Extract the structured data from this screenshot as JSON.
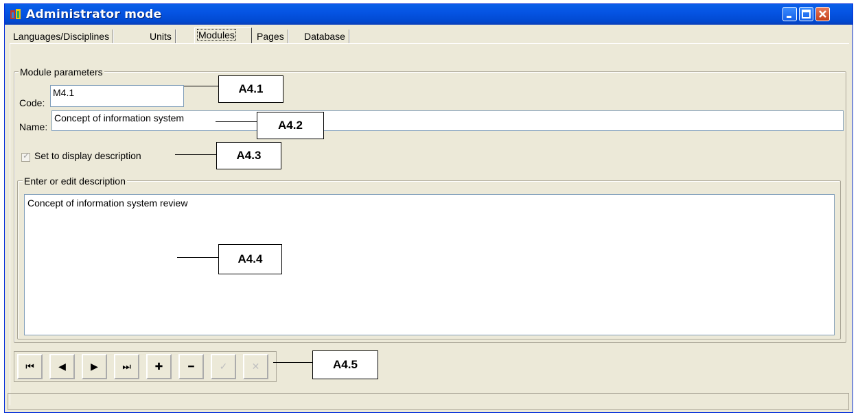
{
  "window": {
    "title": "Administrator mode"
  },
  "tabs": [
    {
      "label": "Languages/Disciplines"
    },
    {
      "label": "Units"
    },
    {
      "label": "Modules"
    },
    {
      "label": "Pages"
    },
    {
      "label": "Database"
    }
  ],
  "module_parameters": {
    "group_title": "Module parameters",
    "code_label": "Code:",
    "code_value": "M4.1",
    "name_label": "Name:",
    "name_value": "Concept of information system",
    "checkbox_label": "Set to display  description",
    "checkbox_checked": true,
    "description_group_title": "Enter or edit description",
    "description_value": "Concept of information system review"
  },
  "navigator": {
    "buttons": [
      {
        "icon": "first-record-icon",
        "glyph": "⏮"
      },
      {
        "icon": "prior-record-icon",
        "glyph": "◀"
      },
      {
        "icon": "next-record-icon",
        "glyph": "▶"
      },
      {
        "icon": "last-record-icon",
        "glyph": "⏭"
      },
      {
        "icon": "insert-record-icon",
        "glyph": "✚"
      },
      {
        "icon": "delete-record-icon",
        "glyph": "━"
      },
      {
        "icon": "post-record-icon",
        "glyph": "✓"
      },
      {
        "icon": "cancel-record-icon",
        "glyph": "✕"
      }
    ]
  },
  "callouts": {
    "a41": "A4.1",
    "a42": "A4.2",
    "a43": "A4.3",
    "a44": "A4.4",
    "a45": "A4.5"
  },
  "colors": {
    "title_bar": "#0554e3",
    "window_face": "#ece9d8",
    "field_border": "#7f9db9"
  }
}
